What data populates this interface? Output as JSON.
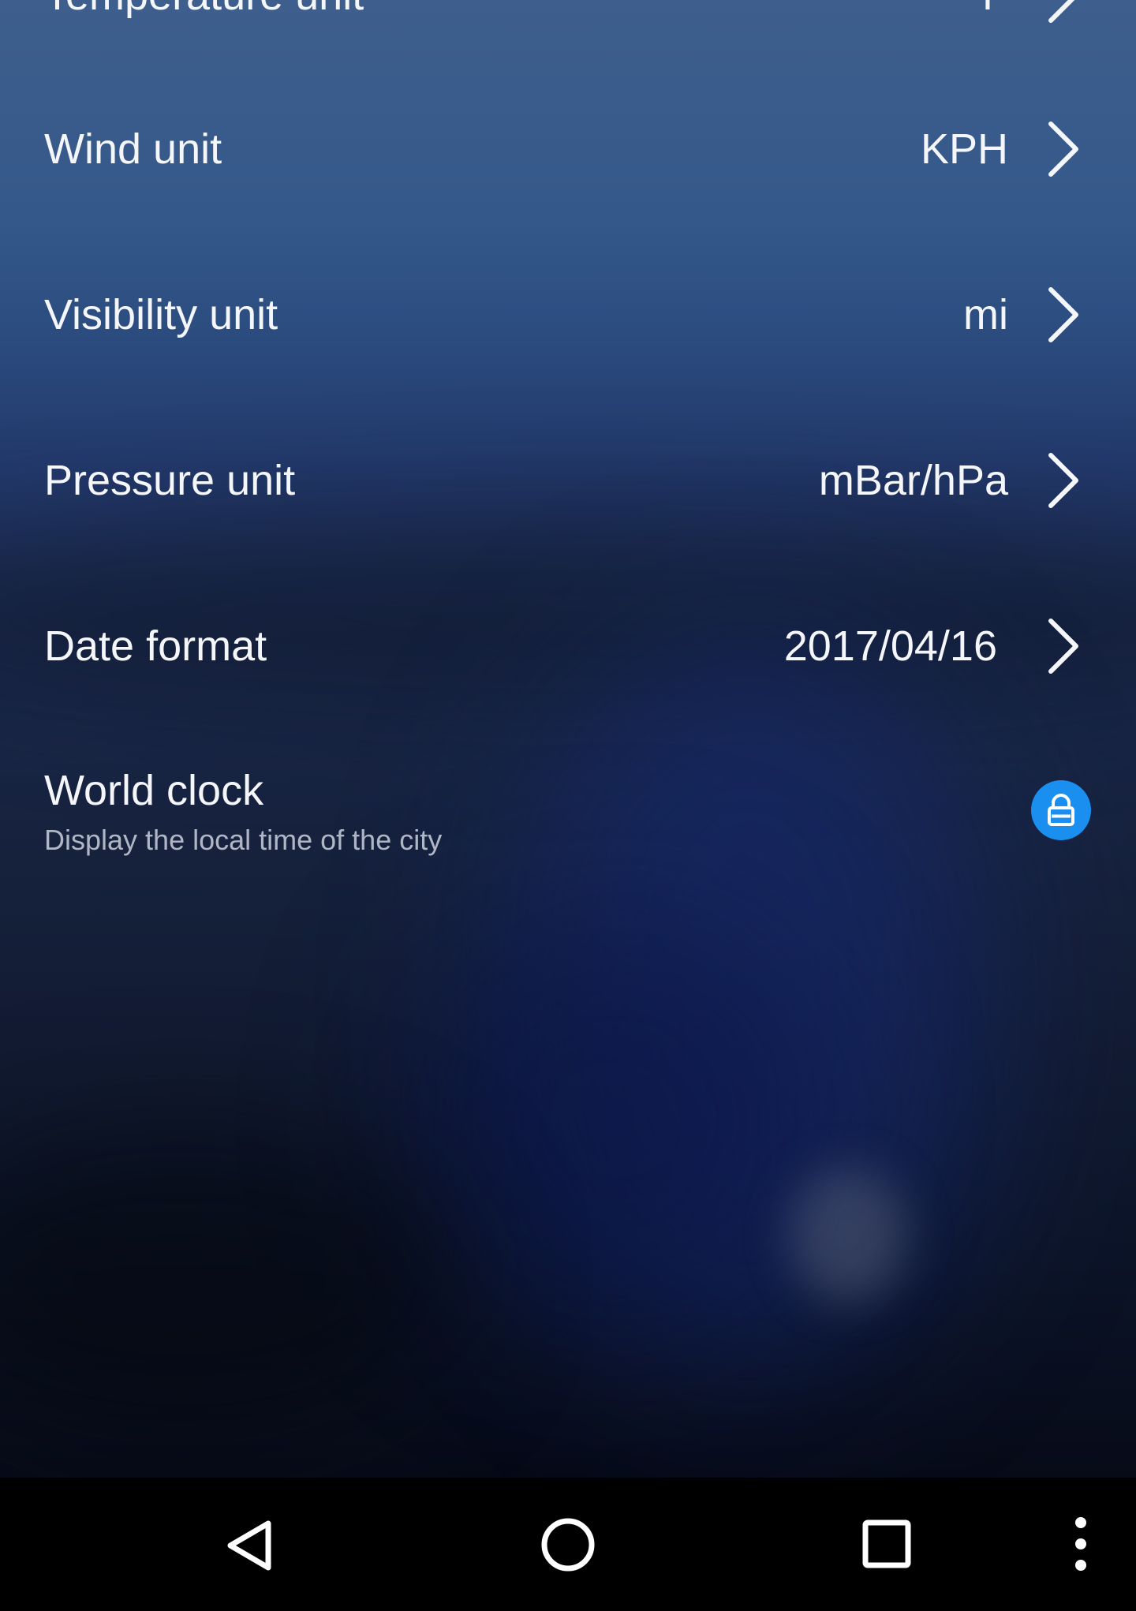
{
  "settings": {
    "temperature": {
      "label": "Temperature unit",
      "value": "°F"
    },
    "wind": {
      "label": "Wind unit",
      "value": "KPH"
    },
    "visibility": {
      "label": "Visibility unit",
      "value": "mi"
    },
    "pressure": {
      "label": "Pressure unit",
      "value": "mBar/hPa"
    },
    "date_format": {
      "label": "Date format",
      "value": "2017/04/16"
    },
    "world_clock": {
      "label": "World clock",
      "description": "Display the local time of the city",
      "state": "locked"
    }
  },
  "icons": {
    "row_chevron": "chevron-right-icon",
    "world_clock_toggle": "lock-icon",
    "nav_back": "back-triangle-icon",
    "nav_home": "home-circle-icon",
    "nav_recents": "recents-square-icon",
    "nav_menu": "more-vertical-icon"
  },
  "colors": {
    "accent": "#1a8ff0",
    "navbar": "#000000",
    "text": "#f4f6fa"
  }
}
